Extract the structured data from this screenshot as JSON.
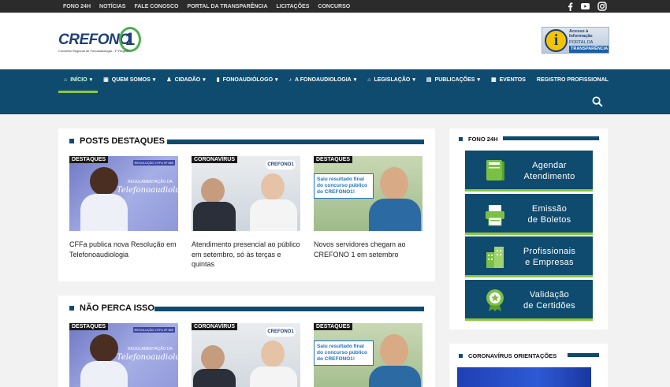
{
  "topbar": {
    "links": [
      "FONO 24H",
      "NOTÍCIAS",
      "FALE CONOSCO",
      "PORTAL DA TRANSPARÊNCIA",
      "LICITAÇÕES",
      "CONCURSO"
    ],
    "social": [
      "facebook-icon",
      "youtube-icon",
      "instagram-icon"
    ]
  },
  "logo": {
    "word": "CREFONO",
    "number": "1",
    "subtitle": "Conselho Regional de Fonoaudiologia - 1ª Região"
  },
  "portal": {
    "icon_letter": "i",
    "line1": "Acesso à Informação",
    "line2": "PORTAL DA",
    "line3": "TRANSPARÊNCIA"
  },
  "nav": {
    "items": [
      {
        "label": "INÍCIO",
        "icon": "home-icon",
        "glyph": "⌂",
        "dropdown": "▾",
        "active": true
      },
      {
        "label": "QUEM SOMOS",
        "icon": "building-icon",
        "glyph": "▣",
        "dropdown": "▾"
      },
      {
        "label": "CIDADÃO",
        "icon": "person-icon",
        "glyph": "♟",
        "dropdown": "▾"
      },
      {
        "label": "FONOAUDIÓLOGO",
        "icon": "phone-icon",
        "glyph": "▮",
        "dropdown": "▾"
      },
      {
        "label": "A FONOAUDIOLOGIA",
        "icon": "microphone-icon",
        "glyph": "♪",
        "dropdown": "▾"
      },
      {
        "label": "LEGISLAÇÃO",
        "icon": "institution-icon",
        "glyph": "⌂",
        "dropdown": "▾"
      },
      {
        "label": "PUBLICAÇÕES",
        "icon": "newspaper-icon",
        "glyph": "▤",
        "dropdown": "▾"
      },
      {
        "label": "EVENTOS",
        "icon": "calendar-icon",
        "glyph": "▦",
        "dropdown": ""
      },
      {
        "label": "REGISTRO PROFISSIONAL",
        "icon": "",
        "glyph": "",
        "dropdown": ""
      }
    ]
  },
  "posts_destaques": {
    "title": "POSTS DESTAQUES",
    "posts": [
      {
        "tag": "DESTAQUES",
        "title": "CFFa publica nova Resolução em Telefonoaudiologia",
        "image_text": "Telefonoaudiologia",
        "image_kicker": "REGULAMENTAÇÃO DA",
        "image_badge": "RESOLUÇÃO CFFa Nº 580"
      },
      {
        "tag": "CORONAVÍRUS",
        "title": "Atendimento presencial ao público em setembro, só às terças e quintas"
      },
      {
        "tag": "DESTAQUES",
        "title": "Novos servidores chegam ao CREFONO 1 em setembro",
        "image_text": "Saiu resultado final do concurso público do CREFONO1!"
      }
    ]
  },
  "nao_perca": {
    "title": "NÃO PERCA ISSO",
    "posts": [
      {
        "tag": "DESTAQUES",
        "image_text": "Telefonoaudiologia",
        "image_kicker": "REGULAMENTAÇÃO DA",
        "image_badge": "RESOLUÇÃO CFFa Nº 580"
      },
      {
        "tag": "CORONAVÍRUS"
      },
      {
        "tag": "DESTAQUES",
        "image_text": "Saiu resultado final do concurso público do CREFONO1!"
      }
    ]
  },
  "sidebar": {
    "fono24h_title": "FONO 24H",
    "buttons": [
      {
        "label": "Agendar\nAtendimento",
        "icon": "book-icon"
      },
      {
        "label": "Emissão\nde Boletos",
        "icon": "printer-icon"
      },
      {
        "label": "Profissionais\ne Empresas",
        "icon": "buildings-icon"
      },
      {
        "label": "Validação\nde Certidões",
        "icon": "certificate-icon"
      }
    ],
    "corona_title": "CORONAVÍRUS ORIENTAÇÕES"
  },
  "colors": {
    "navy": "#0f4b6e",
    "accent_green": "#8dc63f",
    "topbar": "#2b2b2b"
  }
}
